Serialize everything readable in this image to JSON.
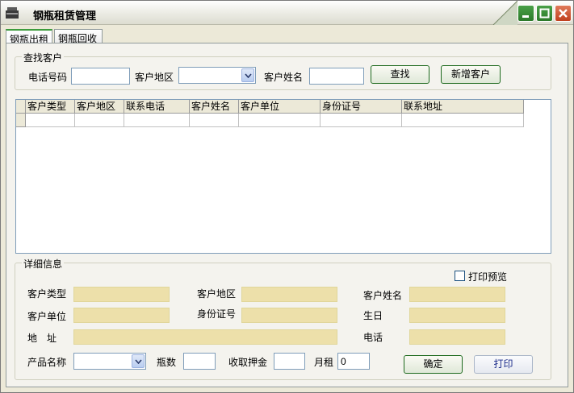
{
  "window": {
    "title": "钢瓶租赁管理",
    "app_icon": "toolbox-icon",
    "controls": [
      "minimize-icon",
      "maximize-icon",
      "close-icon"
    ]
  },
  "tabs": [
    {
      "label": "钢瓶出租",
      "active": true
    },
    {
      "label": "钢瓶回收",
      "active": false
    }
  ],
  "search": {
    "group_title": "查找客户",
    "phone_label": "电话号码",
    "phone_value": "",
    "region_label": "客户地区",
    "region_value": "",
    "name_label": "客户姓名",
    "name_value": "",
    "find_button": "查找",
    "new_button": "新增客户"
  },
  "grid": {
    "columns": [
      "客户类型",
      "客户地区",
      "联系电话",
      "客户姓名",
      "客户单位",
      "身份证号",
      "联系地址"
    ],
    "rows": [
      [
        "",
        "",
        "",
        "",
        "",
        "",
        ""
      ]
    ]
  },
  "detail": {
    "group_title": "详细信息",
    "print_preview_label": "打印预览",
    "print_preview_checked": false,
    "customer_type_label": "客户类型",
    "customer_region_label": "客户地区",
    "customer_name_label": "客户姓名",
    "customer_company_label": "客户单位",
    "id_number_label": "身份证号",
    "birthday_label": "生日",
    "address_label": "地　址",
    "phone_label": "电话",
    "product_label": "产品名称",
    "product_value": "",
    "bottle_count_label": "瓶数",
    "bottle_count_value": "",
    "deposit_label": "收取押金",
    "deposit_value": "",
    "monthly_rent_label": "月租",
    "monthly_rent_value": "0",
    "confirm_button": "确定",
    "print_button": "打印"
  },
  "colors": {
    "readonly_field": "#ede0aa",
    "tab_accent": "#3c9b3c",
    "close_button": "#c0401e",
    "window_button": "#2c7a2a"
  }
}
